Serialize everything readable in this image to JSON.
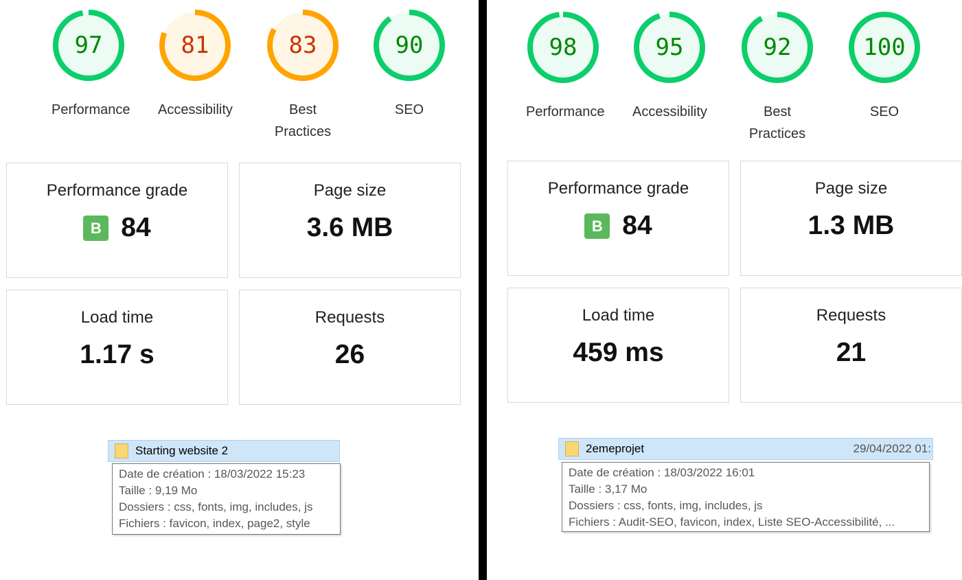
{
  "colors": {
    "good": "#0cce6b",
    "good_text": "#008800",
    "average": "#ffa400",
    "average_text": "#cc3300",
    "grade_badge": "#5cb85c"
  },
  "left": {
    "gauges": [
      {
        "score": "97",
        "label": "Performance",
        "rating": "good"
      },
      {
        "score": "81",
        "label": "Accessibility",
        "rating": "average"
      },
      {
        "score": "83",
        "label": "Best Practices",
        "rating": "average"
      },
      {
        "score": "90",
        "label": "SEO",
        "rating": "good"
      }
    ],
    "cards": {
      "performance_grade_title": "Performance grade",
      "grade_letter": "B",
      "grade_value": "84",
      "page_size_title": "Page size",
      "page_size_value": "3.6 MB",
      "load_time_title": "Load time",
      "load_time_value": "1.17 s",
      "requests_title": "Requests",
      "requests_value": "26"
    },
    "tooltip": {
      "folder_name": "Starting website 2",
      "date_right": "",
      "lines": [
        "Date de création : 18/03/2022 15:23",
        "Taille : 9,19 Mo",
        "Dossiers : css, fonts, img, includes, js",
        "Fichiers : favicon, index, page2, style"
      ]
    }
  },
  "right": {
    "gauges": [
      {
        "score": "98",
        "label": "Performance",
        "rating": "good"
      },
      {
        "score": "95",
        "label": "Accessibility",
        "rating": "good"
      },
      {
        "score": "92",
        "label": "Best Practices",
        "rating": "good"
      },
      {
        "score": "100",
        "label": "SEO",
        "rating": "good"
      }
    ],
    "cards": {
      "performance_grade_title": "Performance grade",
      "grade_letter": "B",
      "grade_value": "84",
      "page_size_title": "Page size",
      "page_size_value": "1.3 MB",
      "load_time_title": "Load time",
      "load_time_value": "459 ms",
      "requests_title": "Requests",
      "requests_value": "21"
    },
    "tooltip": {
      "folder_name": "2emeprojet",
      "date_right": "29/04/2022 01:",
      "lines": [
        "Date de création : 18/03/2022 16:01",
        "Taille : 3,17 Mo",
        "Dossiers : css, fonts, img, includes, js",
        "Fichiers : Audit-SEO, favicon, index, Liste SEO-Accessibilité, ..."
      ]
    }
  }
}
